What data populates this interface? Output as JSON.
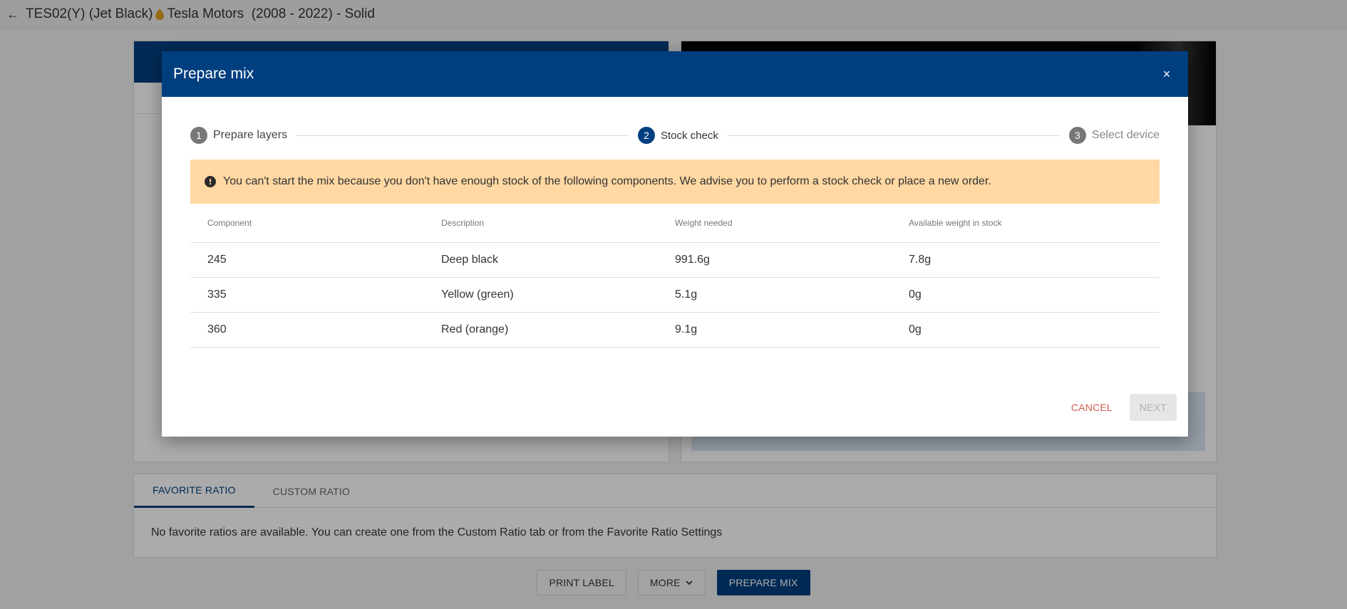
{
  "header": {
    "title_prefix": "TES02(Y) (Jet Black)",
    "title_suffix": "Tesla Motors  (2008 - 2022) - Solid"
  },
  "ratio": {
    "tabs": [
      {
        "label": "FAVORITE RATIO",
        "active": true
      },
      {
        "label": "CUSTOM RATIO",
        "active": false
      }
    ],
    "message": "No favorite ratios are available. You can create one from the Custom Ratio tab or from the Favorite Ratio Settings"
  },
  "actions": {
    "print_label": "PRINT LABEL",
    "more": "MORE",
    "prepare_mix": "PREPARE MIX"
  },
  "modal": {
    "title": "Prepare mix",
    "close": "×",
    "steps": [
      {
        "num": "1",
        "label": "Prepare layers",
        "state": "done"
      },
      {
        "num": "2",
        "label": "Stock check",
        "state": "current"
      },
      {
        "num": "3",
        "label": "Select device",
        "state": "pending"
      }
    ],
    "alert": "You can't start the mix because you don't have enough stock of the following components. We advise you to perform a stock check or place a new order.",
    "alert_icon": "!",
    "table": {
      "headers": [
        "Component",
        "Description",
        "Weight needed",
        "Available weight in stock"
      ],
      "rows": [
        [
          "245",
          "Deep black",
          "991.6g",
          "7.8g"
        ],
        [
          "335",
          "Yellow (green)",
          "5.1g",
          "0g"
        ],
        [
          "360",
          "Red (orange)",
          "9.1g",
          "0g"
        ]
      ]
    },
    "cancel": "CANCEL",
    "next": "NEXT"
  },
  "colors": {
    "primary": "#003f7f",
    "alert_bg": "#ffd8a3",
    "cancel_text": "#d05a4d"
  }
}
